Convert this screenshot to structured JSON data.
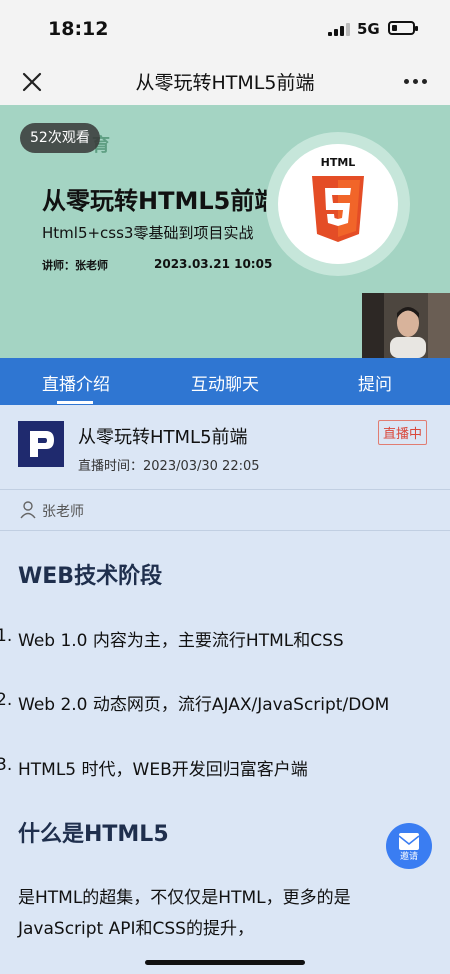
{
  "status": {
    "time": "18:12",
    "network": "5G"
  },
  "nav": {
    "title": "从零玩转HTML5前端"
  },
  "banner": {
    "views": "52次观看",
    "org": "育",
    "title": "从零玩转HTML5前端",
    "subtitle": "Html5+css3零基础到项目实战",
    "teacher": "讲师：张老师",
    "date": "2023.03.21 10:05",
    "logo_text": "HTML",
    "logo_color": "#e44d26"
  },
  "tabs": [
    {
      "label": "直播介绍",
      "active": true
    },
    {
      "label": "互动聊天"
    },
    {
      "label": "提问"
    }
  ],
  "course": {
    "title": "从零玩转HTML5前端",
    "time": "直播时间：2023/03/30 22:05",
    "status": "直播中"
  },
  "teacher": {
    "name": "张老师"
  },
  "content": {
    "heading1": "WEB技术阶段",
    "items": [
      {
        "num": "1.",
        "text": "Web 1.0 内容为主，主要流行HTML和CSS"
      },
      {
        "num": "2.",
        "text": "Web 2.0 动态网页，流行AJAX/JavaScript/DOM"
      },
      {
        "num": "3.",
        "text": "HTML5 时代，WEB开发回归富客户端"
      }
    ],
    "heading2": "什么是HTML5",
    "para_line1": "是HTML的超集，不仅仅是HTML，更多的是",
    "para_line2": "JavaScript API和CSS的提升，"
  },
  "invite": {
    "label": "邀请"
  }
}
